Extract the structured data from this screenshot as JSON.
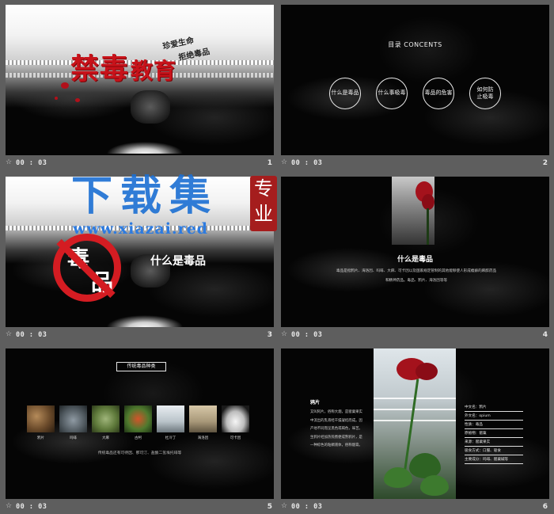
{
  "slides": [
    {
      "number": "1",
      "duration": "00 : 03",
      "title_main": "禁毒",
      "title_sub": "教育",
      "slogan_line1": "珍爱生命",
      "slogan_line2": "拒绝毒品"
    },
    {
      "number": "2",
      "duration": "00 : 03",
      "toc_title": "目录 CONCENTS",
      "toc_items": [
        "什么是毒品",
        "什么事吸毒",
        "毒品的危害",
        "如何防止吸毒"
      ]
    },
    {
      "number": "3",
      "duration": "00 : 03",
      "ban_char1": "毒",
      "ban_char2": "品",
      "heading": "什么是毒品"
    },
    {
      "number": "4",
      "duration": "00 : 03",
      "heading": "什么是毒品",
      "body": "毒品是指鸦片、海洛因、吗啡、大麻、可卡因以及国家规定管制的其他能够使人形成瘾癖的麻醉药品和精神药品。毒品、鸦片、海洛因等等"
    },
    {
      "number": "5",
      "duration": "00 : 03",
      "tag": "传统毒品种类",
      "drugs": [
        "鸦片",
        "吗啡",
        "大麻",
        "古柯",
        "杜冷丁",
        "海洛因",
        "可卡因"
      ],
      "note": "传统毒品还有可待因、那可汀、盐酸二氢埃托啡等"
    },
    {
      "number": "6",
      "duration": "00 : 03",
      "name": "鸦片",
      "desc": "又叫阿片，俗称大烟，是罂粟果实中流出的乳液经干燥凝结而成。因产地不同而呈黑色或褐色，味苦。生鸦片经加热煎煮便成熟鸦片，是一种棕色的粘稠液体，俗称烟膏。",
      "facts": [
        "中文名：鸦片",
        "外文名：opium",
        "性质：毒品",
        "原植物：罂粟",
        "来源：罂粟果实",
        "吸食方式：口服、吸食",
        "主要成分：吗啡、罂粟碱等"
      ]
    }
  ],
  "watermark": {
    "title": "下载集",
    "url": "www.xiazai.red",
    "seal": "专业"
  },
  "colors": {
    "accent_red": "#c8121a",
    "watermark_blue": "#1b6fd3",
    "background": "#5e5e5e"
  }
}
